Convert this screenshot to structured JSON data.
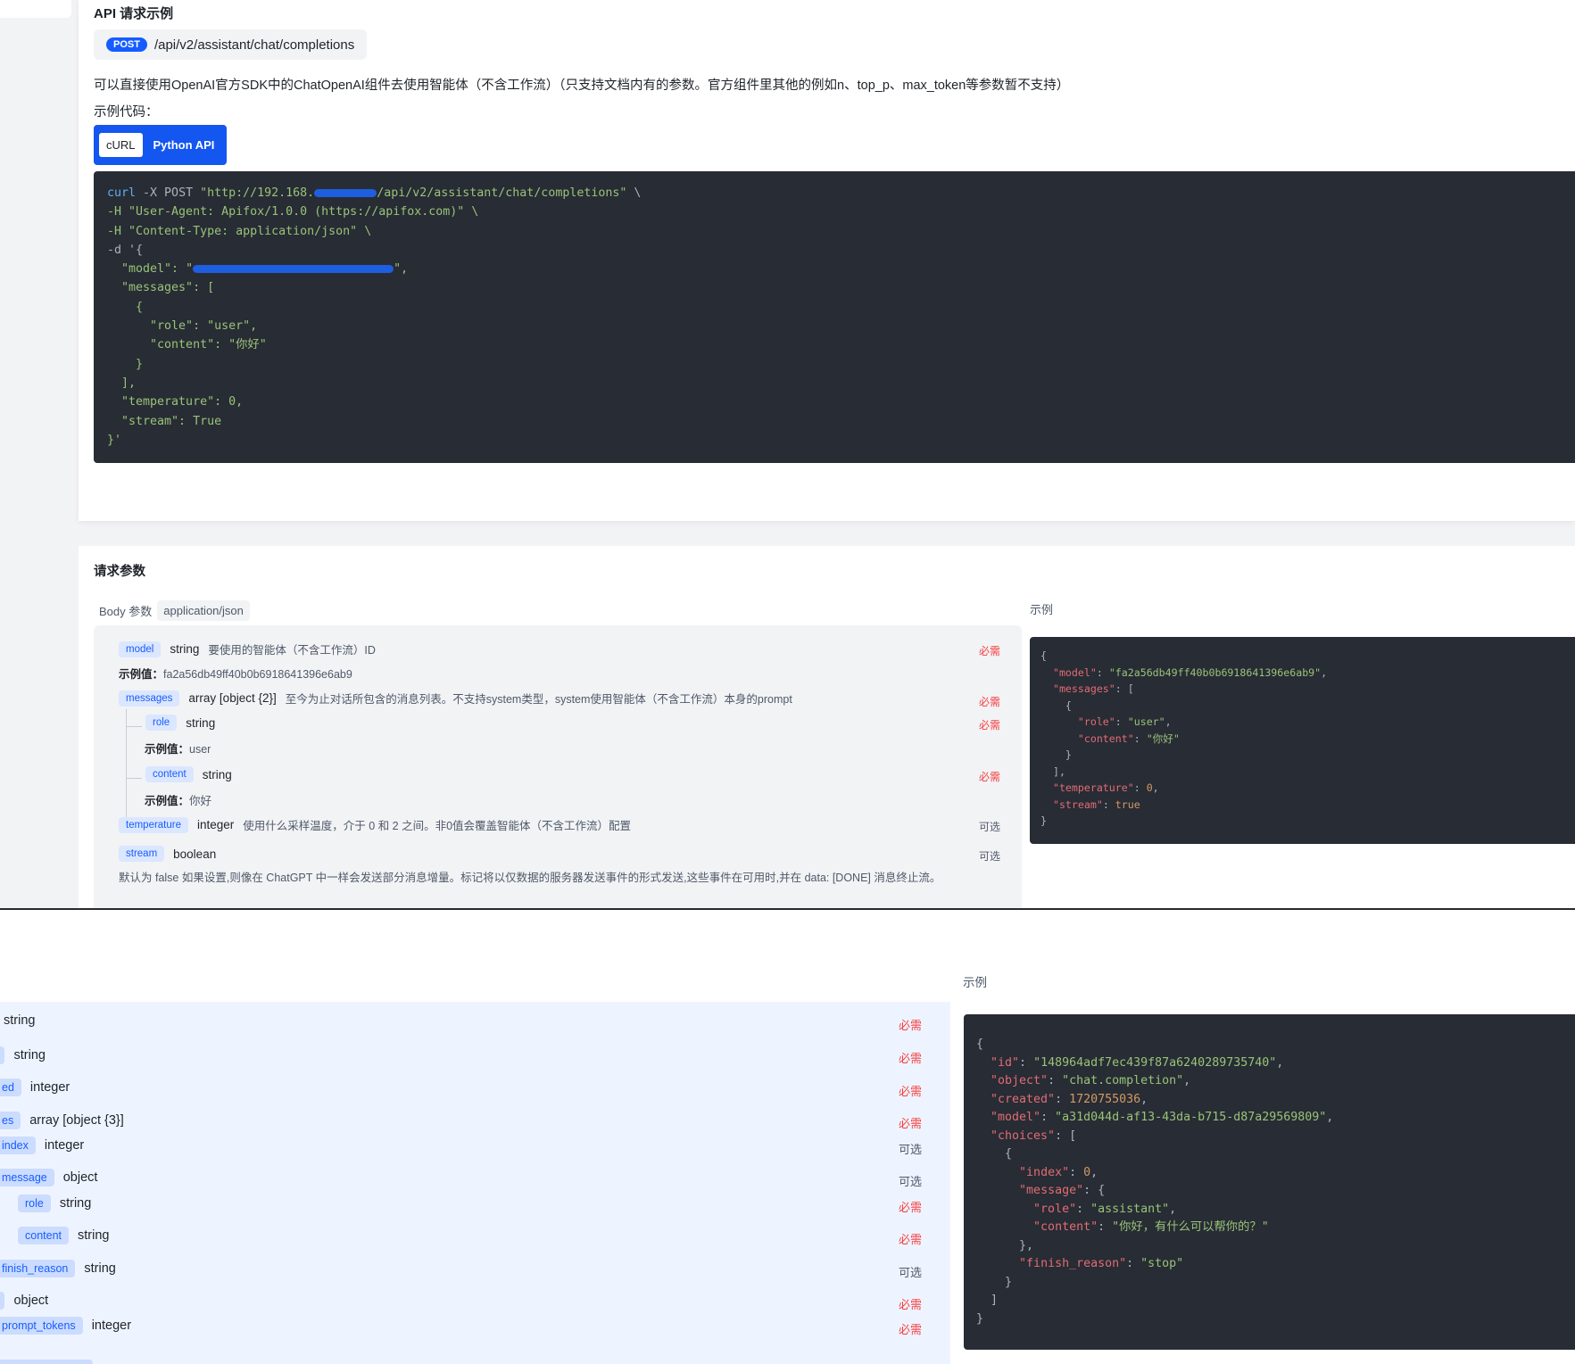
{
  "example_section": {
    "title": "API 请求示例",
    "method": "POST",
    "endpoint": "/api/v2/assistant/chat/completions",
    "description": "可以直接使用OpenAI官方SDK中的ChatOpenAI组件去使用智能体（不含工作流）（只支持文档内有的参数。官方组件里其他的例如n、top_p、max_token等参数暂不支持）",
    "sample_code_label": "示例代码：",
    "tabs": [
      "cURL",
      "Python API"
    ],
    "active_tab": "cURL",
    "code": {
      "line1_cmd": "curl",
      "line1_flags": " -X POST ",
      "line1_url_start": "\"http://192.168.",
      "line1_url_end": "/api/v2/assistant/chat/completions\"",
      "line1_tail": " \\",
      "line2": "-H \"User-Agent: Apifox/1.0.0 (https://apifox.com)\" \\",
      "line3": "-H \"Content-Type: application/json\" \\",
      "line4": "-d '{",
      "line5_key": "  \"model\": ",
      "line5_tail": "\",",
      "line6": "  \"messages\": [",
      "line7": "    {",
      "line8": "      \"role\": \"user\",",
      "line9": "      \"content\": \"你好\"",
      "line10": "    }",
      "line11": "  ],",
      "line12": "  \"temperature\": 0,",
      "line13": "  \"stream\": True",
      "line14": "}'"
    }
  },
  "params_section": {
    "title": "请求参数",
    "body_label": "Body 参数",
    "content_type": "application/json",
    "example_label": "示例",
    "required_label": "必需",
    "optional_label": "可选",
    "example_value_prefix": "示例值：",
    "params": [
      {
        "name": "model",
        "type": "string",
        "desc": "要使用的智能体（不含工作流）ID",
        "req": "必需",
        "example": "fa2a56db49ff40b0b6918641396e6ab9"
      },
      {
        "name": "messages",
        "type": "array [object {2}]",
        "desc": "至今为止对话所包含的消息列表。不支持system类型，system使用智能体（不含工作流）本身的prompt",
        "req": "必需"
      },
      {
        "name": "role",
        "type": "string",
        "req": "必需",
        "example": "user"
      },
      {
        "name": "content",
        "type": "string",
        "req": "必需",
        "example": "你好"
      },
      {
        "name": "temperature",
        "type": "integer",
        "desc": "使用什么采样温度，介于 0 和 2 之间。非0值会覆盖智能体（不含工作流）配置",
        "req": "可选"
      },
      {
        "name": "stream",
        "type": "boolean",
        "req": "可选",
        "desc": "默认为 false 如果设置,则像在 ChatGPT 中一样会发送部分消息增量。标记将以仅数据的服务器发送事件的形式发送,这些事件在可用时,并在 data: [DONE] 消息终止流。"
      }
    ],
    "json_example": {
      "open": "{",
      "model_key": "\"model\"",
      "model_val": "\"fa2a56db49ff40b0b6918641396e6ab9\"",
      "messages_key": "\"messages\"",
      "role_key": "\"role\"",
      "role_val": "\"user\"",
      "content_key": "\"content\"",
      "content_val": "\"你好\"",
      "temperature_key": "\"temperature\"",
      "temperature_val": "0",
      "stream_key": "\"stream\"",
      "stream_val": "true",
      "close": "}"
    }
  },
  "response_section": {
    "example_label": "示例",
    "fields": [
      {
        "name": "",
        "type": "string",
        "req": "必需"
      },
      {
        "name": "",
        "type": "string",
        "req": "必需"
      },
      {
        "name": "ed",
        "type": "integer",
        "req": "必需"
      },
      {
        "name": "es",
        "type": "array [object {3}]",
        "req": "必需"
      },
      {
        "name": "index",
        "type": "integer",
        "req": "可选"
      },
      {
        "name": "message",
        "type": "object",
        "req": "可选"
      },
      {
        "name": "role",
        "type": "string",
        "req": "必需"
      },
      {
        "name": "content",
        "type": "string",
        "req": "必需"
      },
      {
        "name": "finish_reason",
        "type": "string",
        "req": "可选"
      },
      {
        "name": "",
        "type": "object",
        "req": "必需"
      },
      {
        "name": "prompt_tokens",
        "type": "integer",
        "req": "必需"
      }
    ],
    "json_example": {
      "id_key": "\"id\"",
      "id_val": "\"148964adf7ec439f87a6240289735740\"",
      "object_key": "\"object\"",
      "object_val": "\"chat.completion\"",
      "created_key": "\"created\"",
      "created_val": "1720755036",
      "model_key": "\"model\"",
      "model_val": "\"a31d044d-af13-43da-b715-d87a29569809\"",
      "choices_key": "\"choices\"",
      "index_key": "\"index\"",
      "index_val": "0",
      "message_key": "\"message\"",
      "role_key": "\"role\"",
      "role_val": "\"assistant\"",
      "content_key": "\"content\"",
      "content_val": "\"你好，有什么可以帮你的？\"",
      "finish_key": "\"finish_reason\"",
      "finish_val": "\"stop\""
    }
  },
  "colors": {
    "primary": "#165dff",
    "tab_bar": "#1456f0",
    "code_bg": "#282c34",
    "required": "#f53f3f",
    "page_bg": "#f2f3f5"
  }
}
